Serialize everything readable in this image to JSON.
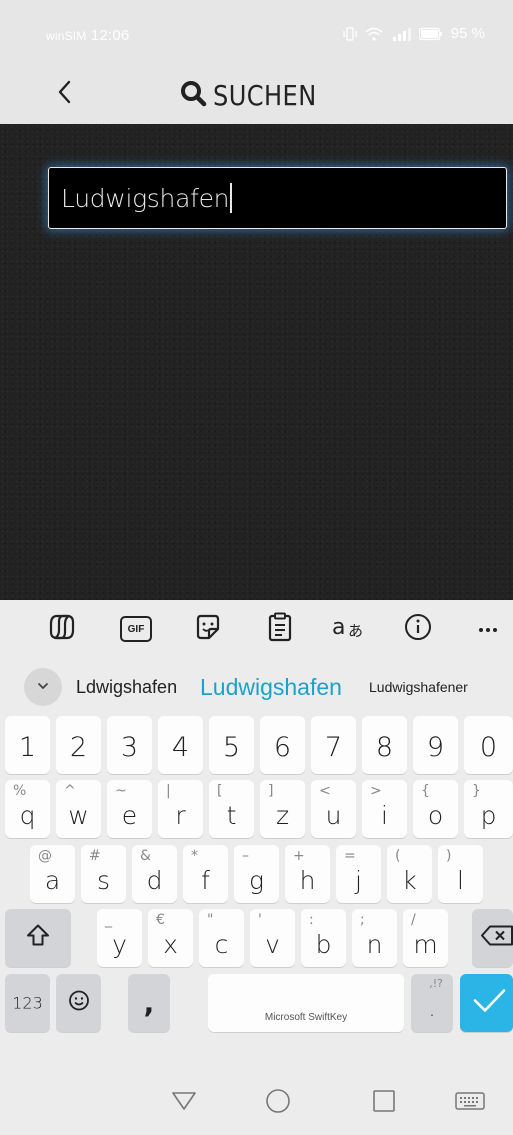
{
  "status_bar": {
    "carrier": "winSIM",
    "time": "12:06",
    "battery_percent": "95 %",
    "icons": [
      "vibrate-icon",
      "wifi-icon",
      "signal-icon",
      "battery-icon"
    ]
  },
  "header": {
    "back_icon": "chevron-left-icon",
    "search_icon": "search-icon",
    "title": "SUCHEN"
  },
  "search": {
    "value": "Ludwigshafen",
    "focused": true
  },
  "keyboard_toolbar": {
    "tools": [
      "copilot-icon",
      "gif-icon",
      "sticker-icon",
      "clipboard-icon",
      "translate-icon",
      "info-icon",
      "more-icon"
    ],
    "gif_label": "GIF"
  },
  "suggestions": {
    "items": [
      "Ldwigshafen",
      "Ludwigshafen",
      "Ludwigshafener"
    ],
    "highlight_color": "#1aa3c9"
  },
  "keys": {
    "numbers": [
      "1",
      "2",
      "3",
      "4",
      "5",
      "6",
      "7",
      "8",
      "9",
      "0"
    ],
    "row1": [
      {
        "main": "q",
        "sub": "%"
      },
      {
        "main": "w",
        "sub": "^"
      },
      {
        "main": "e",
        "sub": "~"
      },
      {
        "main": "r",
        "sub": "|"
      },
      {
        "main": "t",
        "sub": "["
      },
      {
        "main": "z",
        "sub": "]"
      },
      {
        "main": "u",
        "sub": "<"
      },
      {
        "main": "i",
        "sub": ">"
      },
      {
        "main": "o",
        "sub": "{"
      },
      {
        "main": "p",
        "sub": "}"
      }
    ],
    "row2": [
      {
        "main": "a",
        "sub": "@"
      },
      {
        "main": "s",
        "sub": "#"
      },
      {
        "main": "d",
        "sub": "&"
      },
      {
        "main": "f",
        "sub": "*"
      },
      {
        "main": "g",
        "sub": "–"
      },
      {
        "main": "h",
        "sub": "+"
      },
      {
        "main": "j",
        "sub": "="
      },
      {
        "main": "k",
        "sub": "("
      },
      {
        "main": "l",
        "sub": ")"
      }
    ],
    "row3": [
      {
        "main": "y",
        "sub": "_"
      },
      {
        "main": "x",
        "sub": "€"
      },
      {
        "main": "c",
        "sub": "\""
      },
      {
        "main": "v",
        "sub": "'"
      },
      {
        "main": "b",
        "sub": ":"
      },
      {
        "main": "n",
        "sub": ";"
      },
      {
        "main": "m",
        "sub": "/"
      }
    ],
    "num_label": "123",
    "comma": ",",
    "period": ".",
    "period_sub": ",!?",
    "space_label": "Microsoft SwiftKey",
    "accent_color": "#2bb5e6"
  },
  "nav_bar": {
    "icons": [
      "back-triangle-icon",
      "home-circle-icon",
      "recents-square-icon",
      "keyboard-icon"
    ]
  }
}
